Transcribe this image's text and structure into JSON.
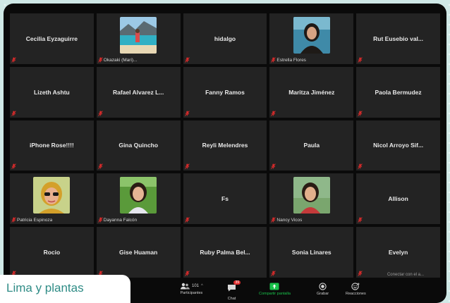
{
  "tiles": [
    {
      "name": "Cecilia Eyzaguirre",
      "label": "",
      "photo": ""
    },
    {
      "name": "",
      "label": "Okazaki (Mari)...",
      "photo": "beach"
    },
    {
      "name": "hidalgo",
      "label": "",
      "photo": ""
    },
    {
      "name": "",
      "label": "Estrella Flores",
      "photo": "woman-dark"
    },
    {
      "name": "Rut Eusebio val...",
      "label": "",
      "photo": ""
    },
    {
      "name": "Lizeth Ashtu",
      "label": "",
      "photo": ""
    },
    {
      "name": "Rafael Alvarez L...",
      "label": "",
      "photo": ""
    },
    {
      "name": "Fanny Ramos",
      "label": "",
      "photo": ""
    },
    {
      "name": "Maritza Jiménez",
      "label": "",
      "photo": ""
    },
    {
      "name": "Paola Bermudez",
      "label": "",
      "photo": ""
    },
    {
      "name": "iPhone Rose!!!!",
      "label": "",
      "photo": ""
    },
    {
      "name": "Gina Quincho",
      "label": "",
      "photo": ""
    },
    {
      "name": "Reyli Melendres",
      "label": "",
      "photo": ""
    },
    {
      "name": "Paula",
      "label": "",
      "photo": ""
    },
    {
      "name": "Nicol Arroyo Sif...",
      "label": "",
      "photo": ""
    },
    {
      "name": "",
      "label": "Patricia Espinoza",
      "photo": "woman-sunglasses"
    },
    {
      "name": "",
      "label": "Dayanna Falcón",
      "photo": "girl"
    },
    {
      "name": "Fs",
      "label": "",
      "photo": ""
    },
    {
      "name": "",
      "label": "Nancy Vicos",
      "photo": "woman-red"
    },
    {
      "name": "Allison",
      "label": "",
      "photo": ""
    },
    {
      "name": "Rocio",
      "label": "",
      "photo": ""
    },
    {
      "name": "Gise Huaman",
      "label": "",
      "photo": ""
    },
    {
      "name": "Ruby Palma Bel...",
      "label": "",
      "photo": ""
    },
    {
      "name": "Sonia Linares",
      "label": "",
      "photo": ""
    },
    {
      "name": "Evelyn",
      "label": "",
      "photo": ""
    }
  ],
  "toolbar": {
    "participants_label": "Participantes",
    "participants_count": "101",
    "chat_label": "Chat",
    "chat_badge": "39",
    "share_label": "Compartir pantalla",
    "record_label": "Grabar",
    "reactions_label": "Reacciones"
  },
  "hover_text": "Conectar con el a...",
  "caption": "Lima y plantas",
  "colors": {
    "background": "#cfe8e6",
    "tile": "#232323",
    "caption_text": "#2f8c86",
    "share_green": "#19c24a",
    "mic_muted": "#e02b2b"
  }
}
